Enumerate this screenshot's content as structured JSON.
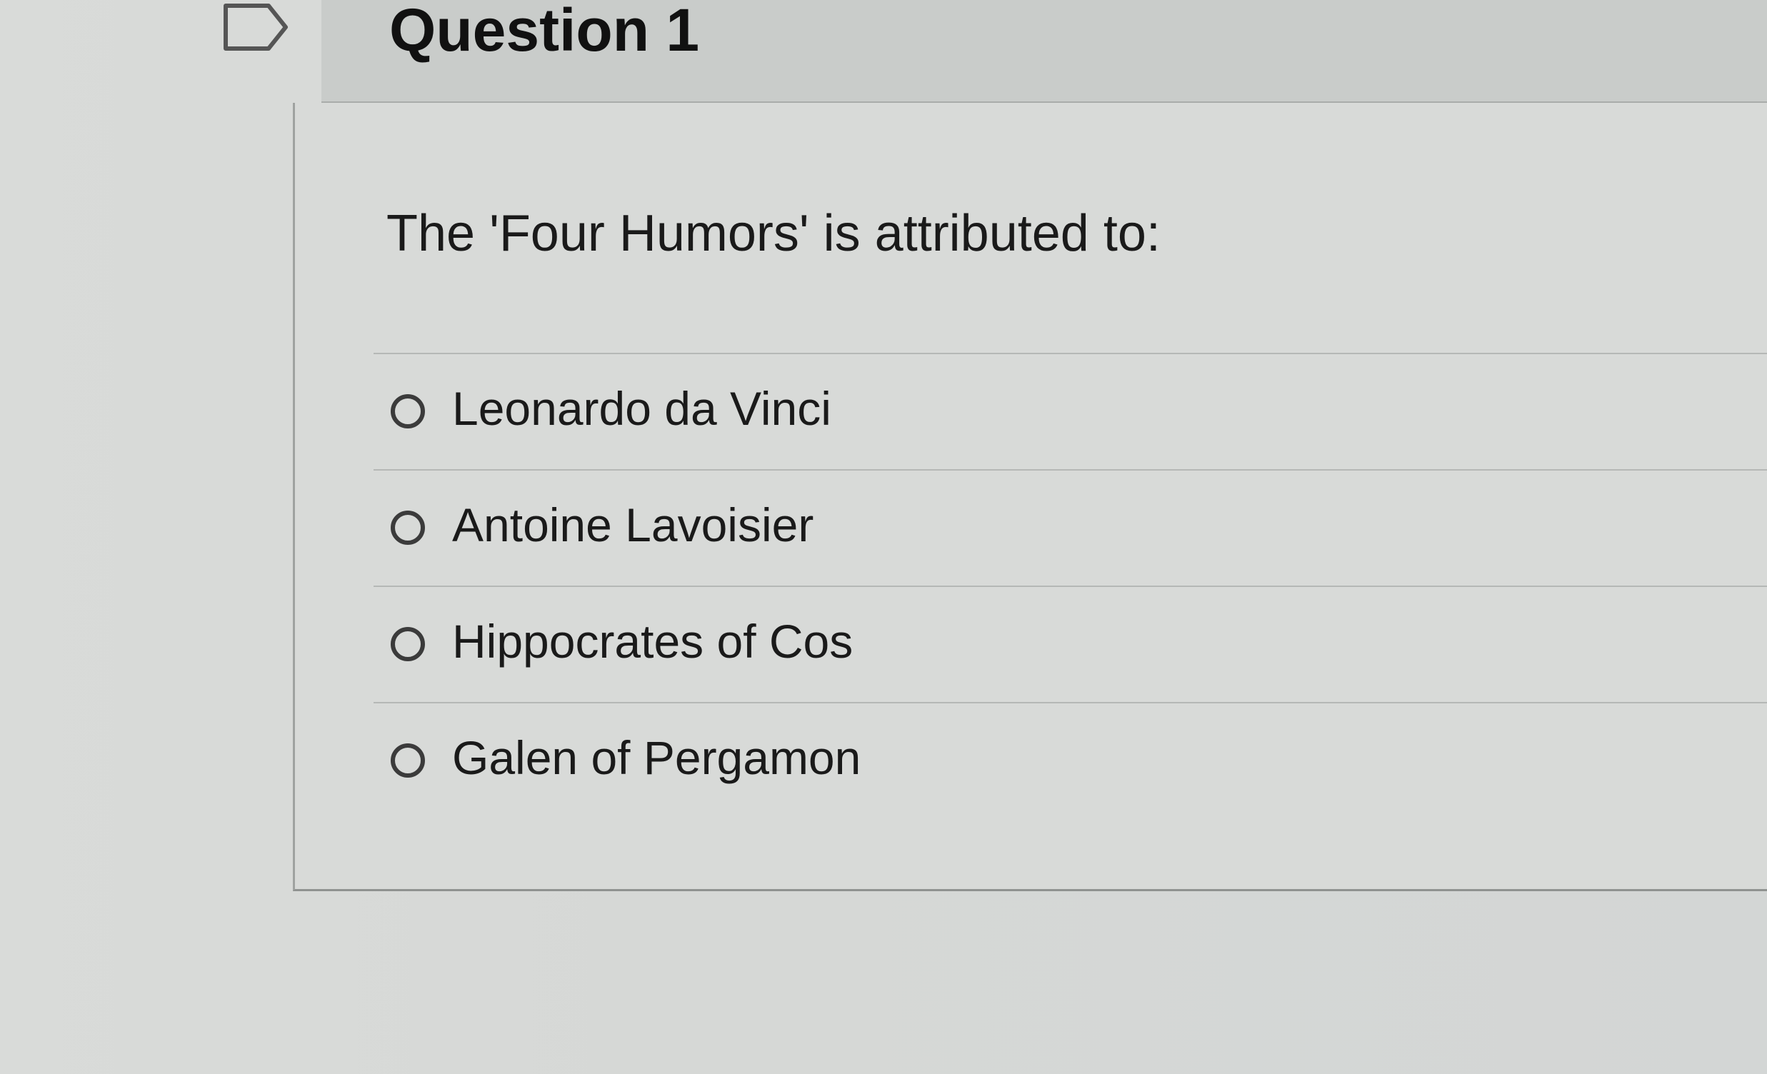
{
  "question": {
    "title": "Question 1",
    "prompt": "The 'Four Humors' is attributed to:"
  },
  "answers": [
    {
      "label": "Leonardo da Vinci",
      "selected": false
    },
    {
      "label": "Antoine Lavoisier",
      "selected": false
    },
    {
      "label": "Hippocrates of Cos",
      "selected": false
    },
    {
      "label": "Galen of Pergamon",
      "selected": false
    }
  ],
  "icons": {
    "flag": "flag-outline-icon",
    "radio": "radio-unselected-icon"
  }
}
